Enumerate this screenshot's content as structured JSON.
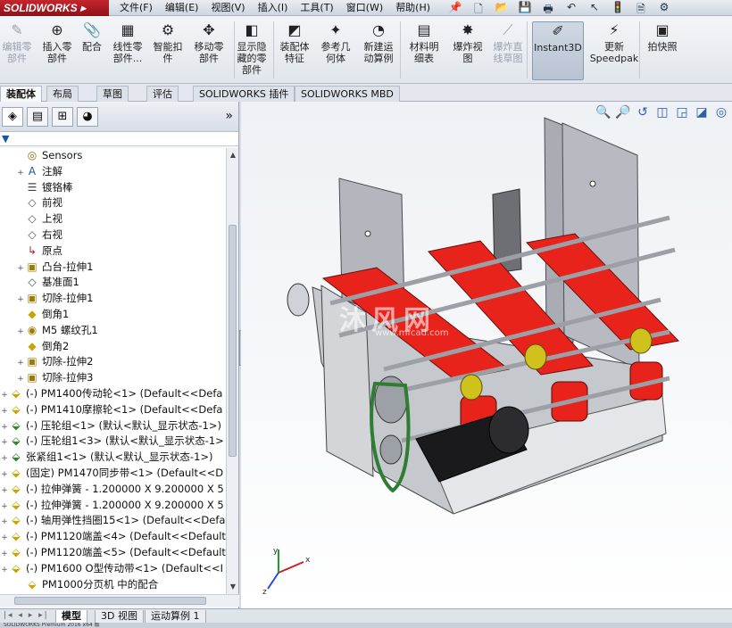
{
  "app": {
    "brand": "SOLIDWORKS"
  },
  "menu": [
    "文件(F)",
    "编辑(E)",
    "视图(V)",
    "插入(I)",
    "工具(T)",
    "窗口(W)",
    "帮助(H)"
  ],
  "quick_access": [
    {
      "icon": "pin-icon",
      "glyph": "📌"
    },
    {
      "icon": "new-document-icon",
      "glyph": "🗋"
    },
    {
      "icon": "open-folder-icon",
      "glyph": "📂"
    },
    {
      "icon": "save-icon",
      "glyph": "💾"
    },
    {
      "icon": "print-icon",
      "glyph": "🖶"
    },
    {
      "icon": "undo-icon",
      "glyph": "↶"
    },
    {
      "icon": "select-pointer-icon",
      "glyph": "↖"
    },
    {
      "icon": "traffic-light-icon",
      "glyph": "🚦"
    },
    {
      "icon": "file-properties-icon",
      "glyph": "🗎"
    },
    {
      "icon": "options-icon",
      "glyph": "⚙"
    }
  ],
  "ribbon": [
    {
      "label": "编辑零\n部件",
      "icon": "edit-component-icon",
      "glyph": "✎",
      "disabled": true
    },
    {
      "label": "插入零\n部件",
      "icon": "insert-component-icon",
      "glyph": "⊕",
      "disabled": false
    },
    {
      "label": "配合",
      "icon": "mate-icon",
      "glyph": "📎",
      "disabled": false
    },
    {
      "label": "线性零\n部件...",
      "icon": "linear-pattern-icon",
      "glyph": "▦",
      "disabled": false
    },
    {
      "label": "智能扣\n件",
      "icon": "smart-fastener-icon",
      "glyph": "⚙",
      "disabled": false
    },
    {
      "label": "移动零\n部件",
      "icon": "move-component-icon",
      "glyph": "✥",
      "disabled": false
    },
    {
      "label": "显示隐\n藏的零\n部件",
      "icon": "show-hidden-icon",
      "glyph": "◧",
      "disabled": false
    },
    {
      "label": "装配体\n特征",
      "icon": "assembly-feature-icon",
      "glyph": "◩",
      "disabled": false
    },
    {
      "label": "参考几\n何体",
      "icon": "reference-geometry-icon",
      "glyph": "✦",
      "disabled": false
    },
    {
      "label": "新建运\n动算例",
      "icon": "new-motion-study-icon",
      "glyph": "◔",
      "disabled": false
    },
    {
      "label": "材料明\n细表",
      "icon": "bill-of-materials-icon",
      "glyph": "▤",
      "disabled": false
    },
    {
      "label": "爆炸视\n图",
      "icon": "exploded-view-icon",
      "glyph": "✸",
      "disabled": false
    },
    {
      "label": "爆炸直\n线草图",
      "icon": "explode-line-sketch-icon",
      "glyph": "⟋",
      "disabled": true
    },
    {
      "label": "Instant3D",
      "icon": "instant3d-icon",
      "glyph": "✐",
      "disabled": false,
      "active": true
    },
    {
      "label": "更新\nSpeedpak",
      "icon": "speedpak-icon",
      "glyph": "⚡",
      "disabled": false
    },
    {
      "label": "拍快照",
      "icon": "snapshot-icon",
      "glyph": "▣",
      "disabled": false
    }
  ],
  "command_tabs": [
    "装配体",
    "布局",
    "草图",
    "评估",
    "SOLIDWORKS 插件",
    "SOLIDWORKS MBD"
  ],
  "panel_tabs": [
    {
      "icon": "feature-manager-icon",
      "glyph": "◈"
    },
    {
      "icon": "property-manager-icon",
      "glyph": "▤"
    },
    {
      "icon": "configuration-manager-icon",
      "glyph": "⊞"
    },
    {
      "icon": "display-manager-icon",
      "glyph": "◕"
    }
  ],
  "panel_more": "»",
  "filter": "▼",
  "tree": [
    {
      "label": "Sensors",
      "icon": "sensor-icon",
      "glyph": "◎",
      "exp": "",
      "indent": 1
    },
    {
      "label": "注解",
      "icon": "annotation-icon",
      "glyph": "A",
      "exp": "+",
      "indent": 1
    },
    {
      "label": "镀铬棒",
      "icon": "material-icon",
      "glyph": "☰",
      "exp": "",
      "indent": 1
    },
    {
      "label": "前视",
      "icon": "plane-icon",
      "glyph": "◇",
      "exp": "",
      "indent": 1
    },
    {
      "label": "上视",
      "icon": "plane-icon",
      "glyph": "◇",
      "exp": "",
      "indent": 1
    },
    {
      "label": "右视",
      "icon": "plane-icon",
      "glyph": "◇",
      "exp": "",
      "indent": 1
    },
    {
      "label": "原点",
      "icon": "origin-icon",
      "glyph": "↳",
      "exp": "",
      "indent": 1
    },
    {
      "label": "凸台-拉伸1",
      "icon": "boss-extrude-icon",
      "glyph": "▣",
      "exp": "+",
      "indent": 1
    },
    {
      "label": "基准面1",
      "icon": "plane-icon",
      "glyph": "◇",
      "exp": "",
      "indent": 1
    },
    {
      "label": "切除-拉伸1",
      "icon": "cut-extrude-icon",
      "glyph": "▣",
      "exp": "+",
      "indent": 1
    },
    {
      "label": "倒角1",
      "icon": "chamfer-icon",
      "glyph": "◆",
      "exp": "",
      "indent": 1
    },
    {
      "label": "M5 螺纹孔1",
      "icon": "hole-wizard-icon",
      "glyph": "◉",
      "exp": "+",
      "indent": 1
    },
    {
      "label": "倒角2",
      "icon": "chamfer-icon",
      "glyph": "◆",
      "exp": "",
      "indent": 1
    },
    {
      "label": "切除-拉伸2",
      "icon": "cut-extrude-icon",
      "glyph": "▣",
      "exp": "+",
      "indent": 1
    },
    {
      "label": "切除-拉伸3",
      "icon": "cut-extrude-icon",
      "glyph": "▣",
      "exp": "+",
      "indent": 1
    },
    {
      "label": "(-) PM1400传动轮<1> (Default<<Defa",
      "icon": "part-icon",
      "glyph": "⬙",
      "exp": "+",
      "indent": 0
    },
    {
      "label": "(-) PM1410摩擦轮<1> (Default<<Defa",
      "icon": "part-icon",
      "glyph": "⬙",
      "exp": "+",
      "indent": 0
    },
    {
      "label": "(-) 压轮组<1> (默认<默认_显示状态-1>)",
      "icon": "subassembly-icon",
      "glyph": "⬙",
      "exp": "+",
      "indent": 0
    },
    {
      "label": "(-) 压轮组1<3> (默认<默认_显示状态-1>",
      "icon": "subassembly-icon",
      "glyph": "⬙",
      "exp": "+",
      "indent": 0
    },
    {
      "label": "张紧组1<1> (默认<默认_显示状态-1>)",
      "icon": "subassembly-icon",
      "glyph": "⬙",
      "exp": "+",
      "indent": 0
    },
    {
      "label": "(固定) PM1470同步带<1> (Default<<D",
      "icon": "part-icon",
      "glyph": "⬙",
      "exp": "+",
      "indent": 0
    },
    {
      "label": "(-) 拉伸弹簧 - 1.200000 X 9.200000 X 5",
      "icon": "part-icon",
      "glyph": "⬙",
      "exp": "+",
      "indent": 0
    },
    {
      "label": "(-) 拉伸弹簧 - 1.200000 X 9.200000 X 5",
      "icon": "part-icon",
      "glyph": "⬙",
      "exp": "+",
      "indent": 0
    },
    {
      "label": "(-) 轴用弹性挡圈15<1> (Default<<Defa",
      "icon": "part-icon",
      "glyph": "⬙",
      "exp": "+",
      "indent": 0
    },
    {
      "label": "(-) PM1120端盖<4> (Default<<Default",
      "icon": "part-icon",
      "glyph": "⬙",
      "exp": "+",
      "indent": 0
    },
    {
      "label": "(-) PM1120端盖<5> (Default<<Default",
      "icon": "part-icon",
      "glyph": "⬙",
      "exp": "+",
      "indent": 0
    },
    {
      "label": "(-) PM1600 O型传动带<1> (Default<<I",
      "icon": "part-icon",
      "glyph": "⬙",
      "exp": "+",
      "indent": 0
    },
    {
      "label": "PM1000分页机 中的配合",
      "icon": "mates-folder-icon",
      "glyph": "⬙",
      "exp": "",
      "indent": 1
    }
  ],
  "viewport_tools": [
    {
      "icon": "zoom-to-fit-icon",
      "glyph": "🔍"
    },
    {
      "icon": "zoom-to-area-icon",
      "glyph": "🔎"
    },
    {
      "icon": "previous-view-icon",
      "glyph": "↺"
    },
    {
      "icon": "section-view-icon",
      "glyph": "◫"
    },
    {
      "icon": "view-orientation-icon",
      "glyph": "◲"
    },
    {
      "icon": "display-style-icon",
      "glyph": "◪"
    },
    {
      "icon": "hide-show-items-icon",
      "glyph": "◎"
    }
  ],
  "watermark": {
    "main": "沐风网",
    "sub": "www.mfcad.com"
  },
  "triad": {
    "x": "x",
    "y": "y",
    "z": "z"
  },
  "bottom_tabs": [
    "模型",
    "3D 视图",
    "运动算例 1"
  ],
  "status": "SOLIDWORKS Premium 2016 x64 版",
  "colors": {
    "belt": "#e8231c",
    "frame": "#b9bcc2",
    "accent": "#c4262e"
  }
}
